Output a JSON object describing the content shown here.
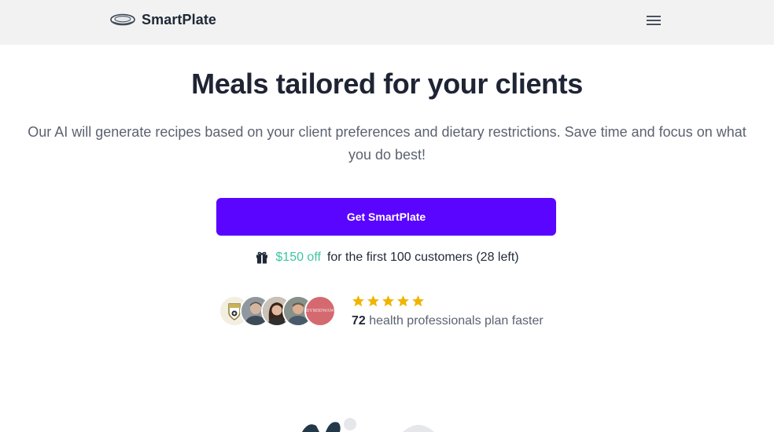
{
  "header": {
    "brand_name": "SmartPlate",
    "logo_icon": "plate-logo-icon",
    "menu_icon": "hamburger-menu-icon"
  },
  "hero": {
    "title": "Meals tailored for your clients",
    "subtitle": "Our AI will generate recipes based on your client preferences and dietary restrictions. Save time and focus on what you do best!",
    "cta_label": "Get SmartPlate"
  },
  "offer": {
    "icon": "gift-icon",
    "discount": "$150 off",
    "text": "for the first 100 customers (28 left)"
  },
  "social_proof": {
    "avatars": [
      {
        "name": "avatar-1",
        "kind": "logo-badge"
      },
      {
        "name": "avatar-2",
        "kind": "photo"
      },
      {
        "name": "avatar-3",
        "kind": "photo"
      },
      {
        "name": "avatar-4",
        "kind": "photo"
      },
      {
        "name": "avatar-5",
        "kind": "text-logo",
        "label": "BYMIDWAW"
      }
    ],
    "rating_stars": 5,
    "count": "72",
    "text": "health professionals plan faster"
  },
  "colors": {
    "accent": "#5a05ff",
    "discount": "#3ec6a0",
    "star": "#f0b400",
    "header_bg": "#f2f2f2"
  }
}
